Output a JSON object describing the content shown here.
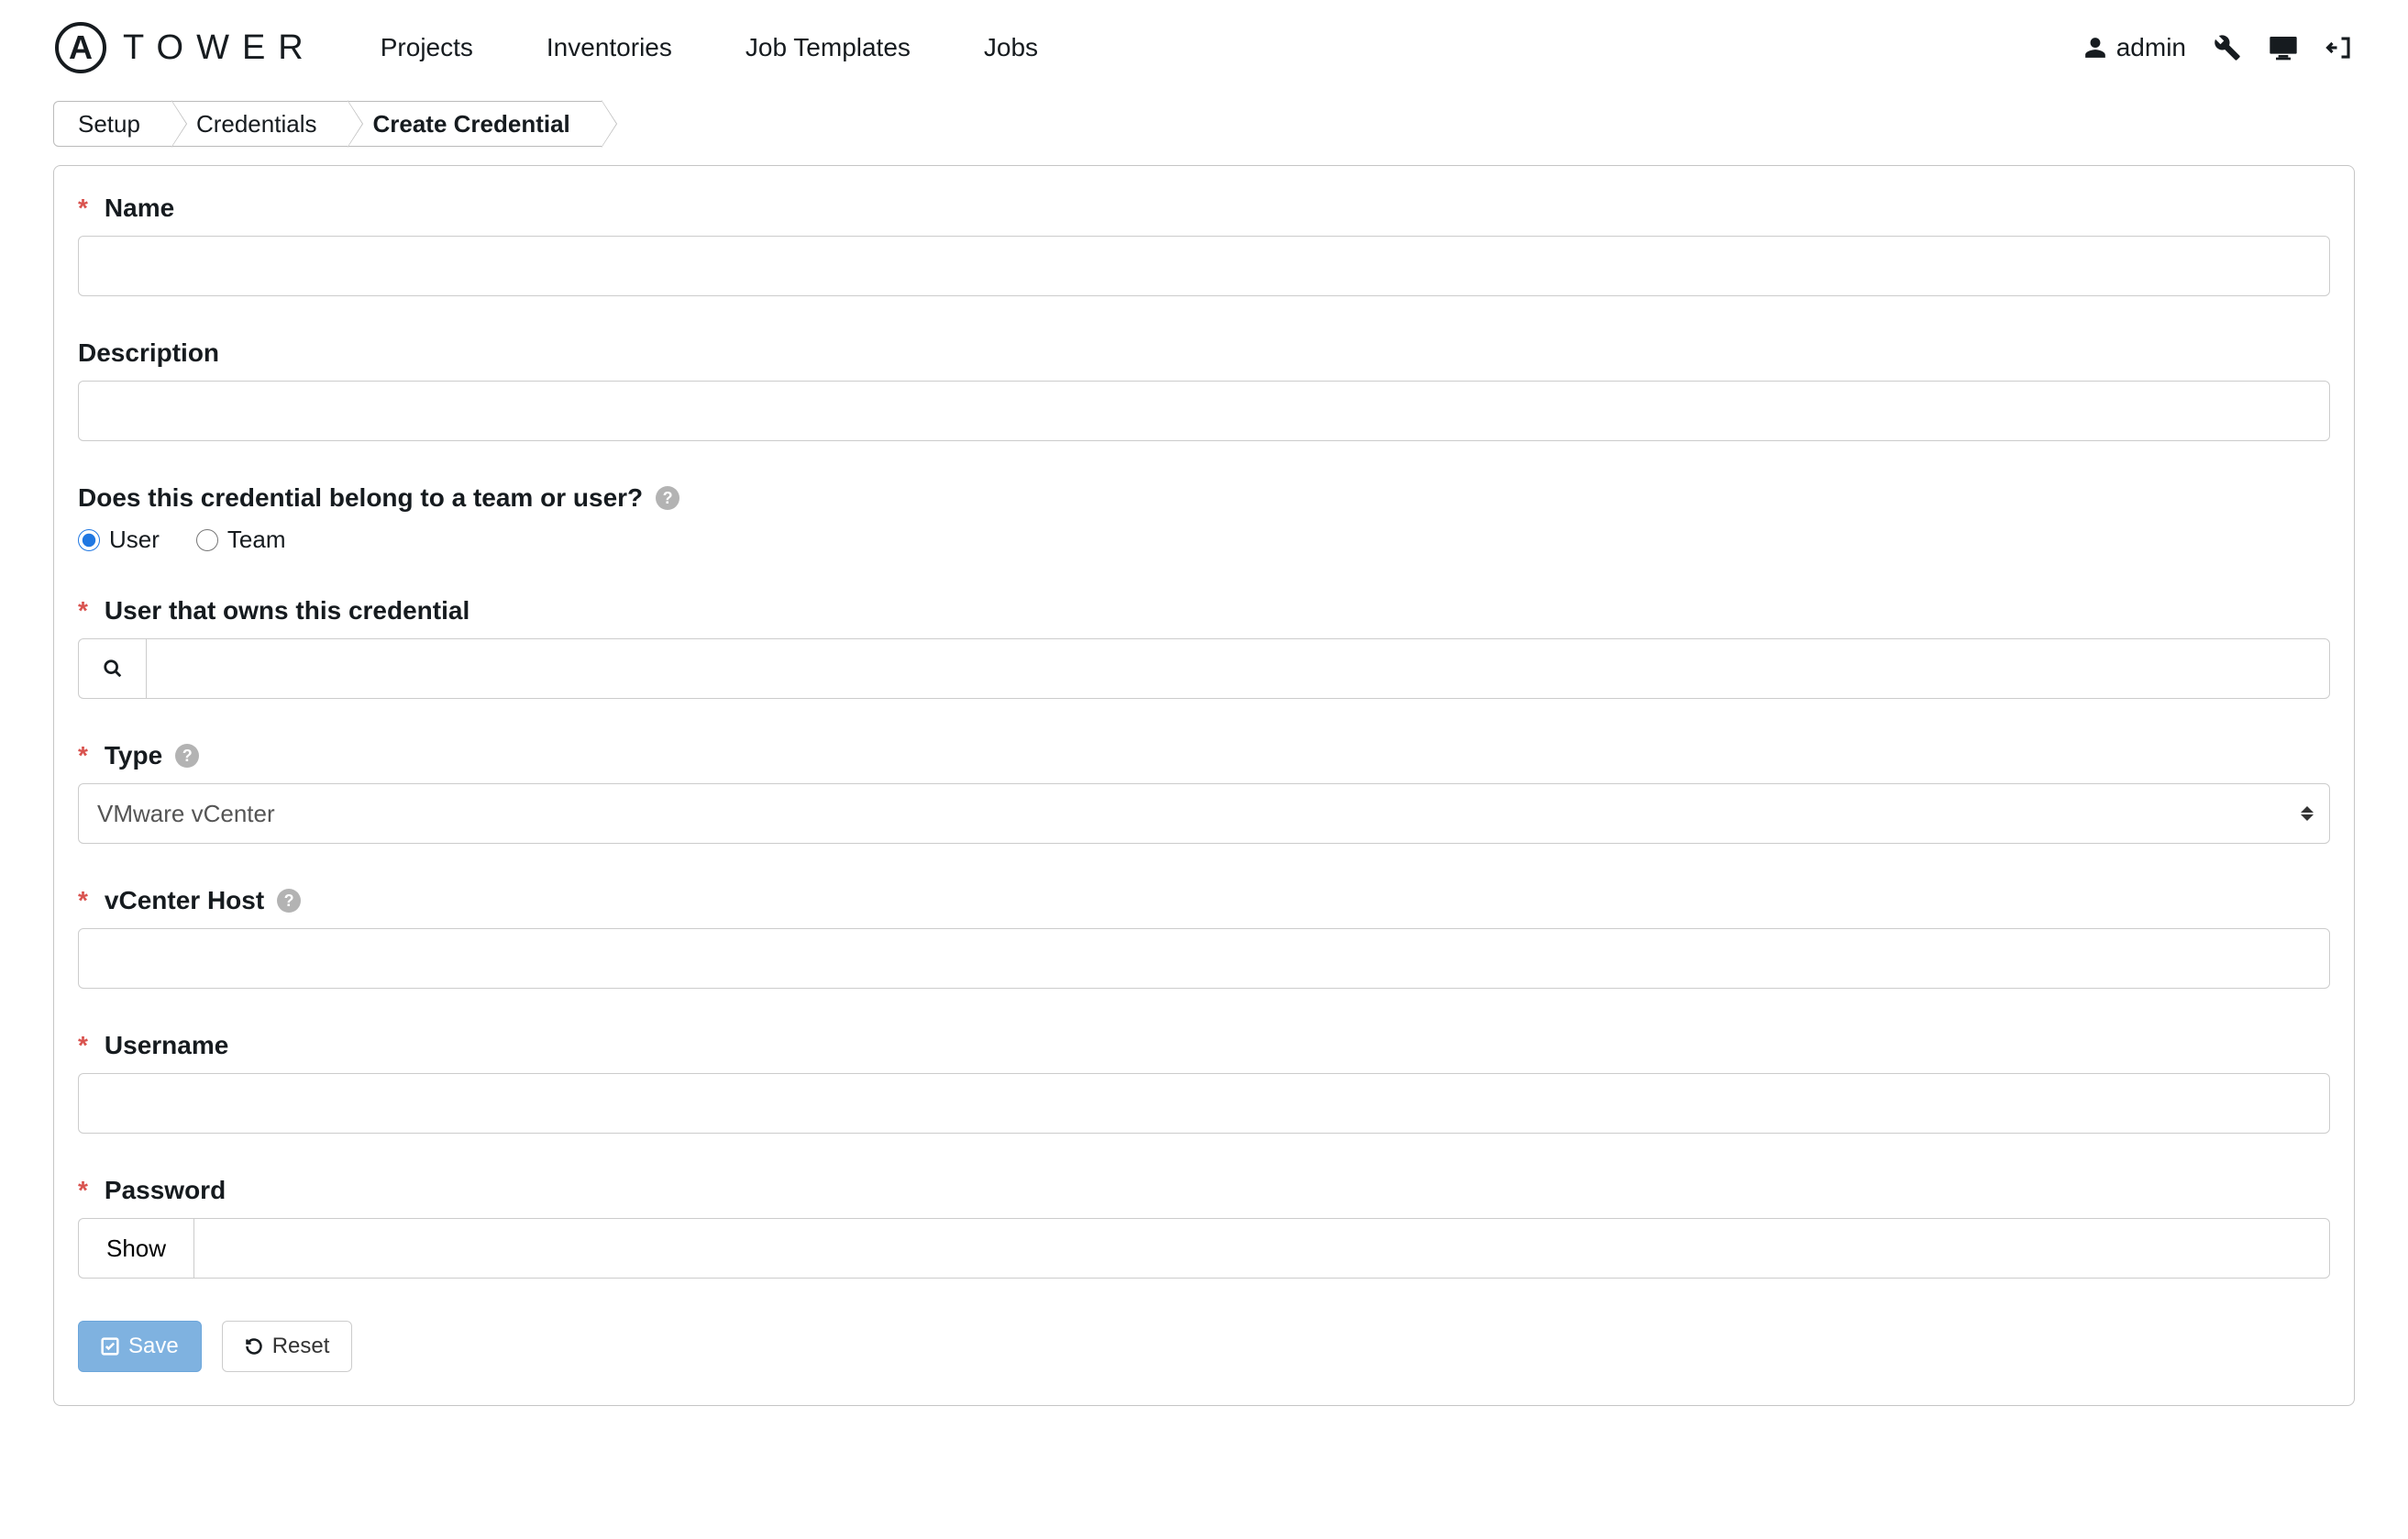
{
  "brand": {
    "logo_letter": "A",
    "name": "TOWER"
  },
  "nav": {
    "projects": "Projects",
    "inventories": "Inventories",
    "job_templates": "Job Templates",
    "jobs": "Jobs"
  },
  "user": {
    "name": "admin"
  },
  "breadcrumb": {
    "setup": "Setup",
    "credentials": "Credentials",
    "create": "Create Credential"
  },
  "form": {
    "name_label": "Name",
    "name_value": "",
    "description_label": "Description",
    "description_value": "",
    "owner_question": "Does this credential belong to a team or user?",
    "radio_user": "User",
    "radio_team": "Team",
    "user_owner_label": "User that owns this credential",
    "user_owner_value": "",
    "type_label": "Type",
    "type_value": "VMware vCenter",
    "vcenter_host_label": "vCenter Host",
    "vcenter_host_value": "",
    "username_label": "Username",
    "username_value": "",
    "password_label": "Password",
    "password_show": "Show",
    "password_value": ""
  },
  "buttons": {
    "save": "Save",
    "reset": "Reset"
  }
}
